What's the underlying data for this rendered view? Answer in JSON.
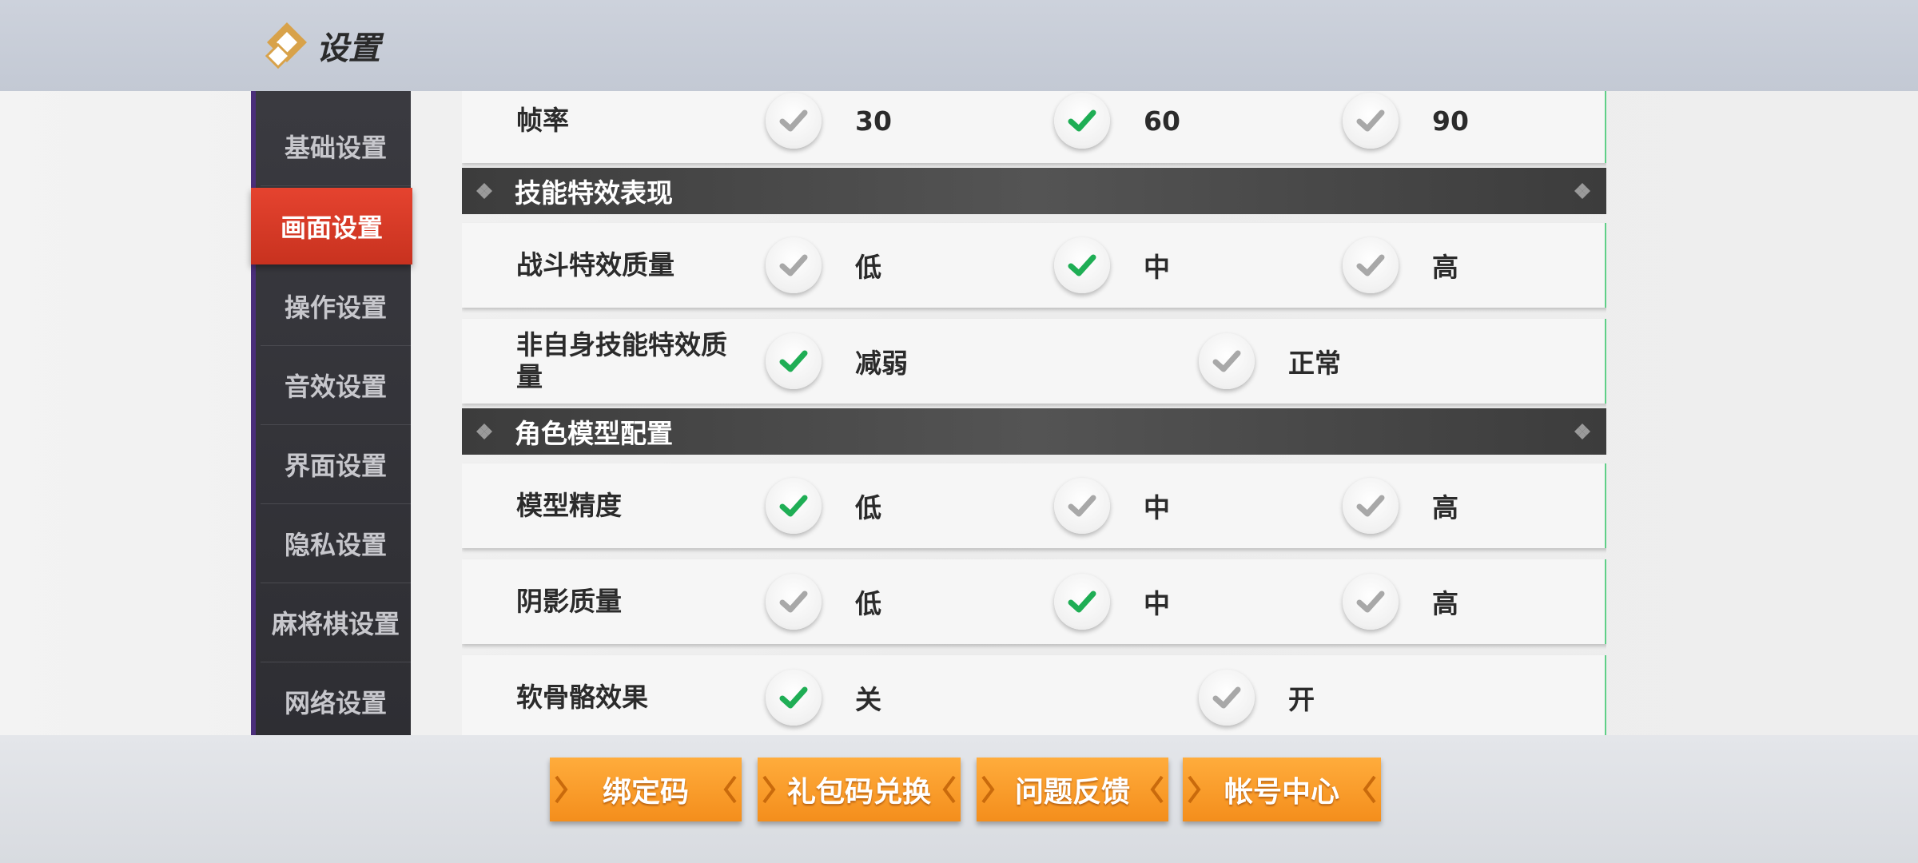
{
  "header": {
    "title": "设置"
  },
  "sidebar": {
    "items": [
      {
        "label": "基础设置"
      },
      {
        "label": "画面设置"
      },
      {
        "label": "操作设置"
      },
      {
        "label": "音效设置"
      },
      {
        "label": "界面设置"
      },
      {
        "label": "隐私设置"
      },
      {
        "label": "麻将棋设置"
      },
      {
        "label": "网络设置"
      }
    ],
    "active": "画面设置"
  },
  "settings": {
    "frame_rate": {
      "label": "帧率",
      "options": [
        "30",
        "60",
        "90"
      ],
      "selected": "60"
    },
    "section_skill": {
      "title": "技能特效表现"
    },
    "combat_fx": {
      "label": "战斗特效质量",
      "options": [
        "低",
        "中",
        "高"
      ],
      "selected": "中"
    },
    "other_skill_fx": {
      "label": "非自身技能特效质量",
      "options": [
        "减弱",
        "正常"
      ],
      "selected": "减弱"
    },
    "section_model": {
      "title": "角色模型配置"
    },
    "model_precision": {
      "label": "模型精度",
      "options": [
        "低",
        "中",
        "高"
      ],
      "selected": "低"
    },
    "shadow_quality": {
      "label": "阴影质量",
      "options": [
        "低",
        "中",
        "高"
      ],
      "selected": "中"
    },
    "soft_bone": {
      "label": "软骨骼效果",
      "options": [
        "关",
        "开"
      ],
      "selected": "关"
    }
  },
  "footer": {
    "bind_code": "绑定码",
    "gift_code": "礼包码兑换",
    "feedback": "问题反馈",
    "account_center": "帐号中心"
  },
  "colors": {
    "accent_active": "#d93a26",
    "check_selected": "#1fae55",
    "check_unselected": "#a8a8a8",
    "button_orange": "#f7991f",
    "row_edge": "#5fcf87"
  }
}
